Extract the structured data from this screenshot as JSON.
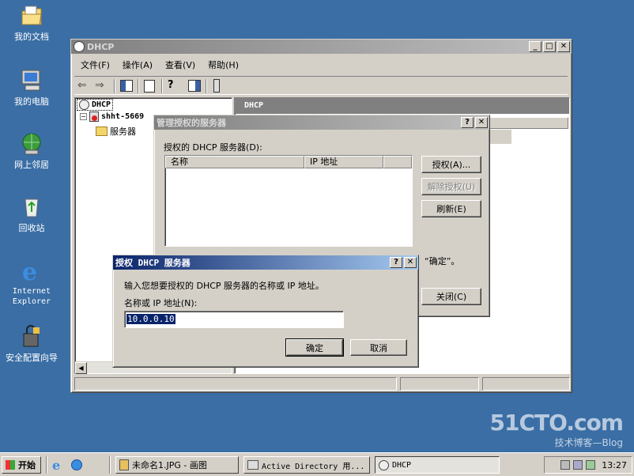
{
  "desktop": {
    "icons": [
      {
        "name": "我的文档"
      },
      {
        "name": "我的电脑"
      },
      {
        "name": "网上邻居"
      },
      {
        "name": "回收站"
      },
      {
        "name": "Internet",
        "name2": "Explorer"
      },
      {
        "name": "安全配置向导"
      }
    ],
    "watermark": {
      "line1": "51CTO.com",
      "line2": "技术博客—Blog"
    }
  },
  "dhcp_window": {
    "title": "DHCP",
    "menu": [
      "文件(F)",
      "操作(A)",
      "查看(V)",
      "帮助(H)"
    ],
    "tree": {
      "root": "DHCP",
      "server": "shht-5669",
      "child": "服务器"
    },
    "right_header": "DHCP"
  },
  "manage_dialog": {
    "title": "管理授权的服务器",
    "label": "授权的 DHCP 服务器(D):",
    "columns": [
      "名称",
      "IP 地址"
    ],
    "buttons": {
      "authorize": "授权(A)...",
      "deauthorize": "解除授权(U)",
      "refresh": "刷新(E)",
      "close": "关闭(C)"
    },
    "partial_text": "“确定”。"
  },
  "auth_dialog": {
    "title": "授权 DHCP 服务器",
    "prompt": "输入您想要授权的 DHCP 服务器的名称或 IP 地址。",
    "field_label": "名称或 IP 地址(N):",
    "field_value": "10.0.0.10",
    "ok": "确定",
    "cancel": "取消"
  },
  "taskbar": {
    "start": "开始",
    "tasks": [
      "未命名1.JPG - 画图",
      "Active Directory 用...",
      "DHCP"
    ],
    "clock": "13:27"
  },
  "colors": {
    "desktop": "#3a6ea5",
    "active_title": "#0a246a",
    "face": "#d4d0c8"
  }
}
